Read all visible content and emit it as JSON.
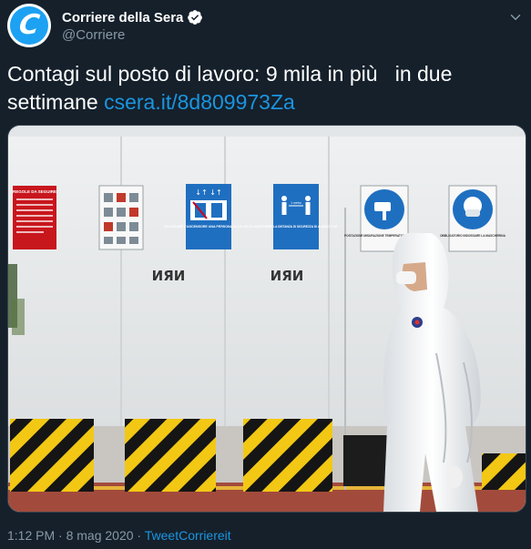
{
  "account": {
    "display_name": "Corriere della Sera",
    "handle": "@Corriere",
    "avatar_letter": "C",
    "verified": true
  },
  "tweet": {
    "text": "Contagi sul posto di lavoro: 9 mila in più   in due settimane ",
    "link": "csera.it/8d809973Za"
  },
  "media": {
    "signs": [
      {
        "title": "REGOLE DA SEGUIRE"
      },
      {
        "title": ""
      },
      {
        "title": "UTILIZZARE L'ASCENSORE UNA PERSONA ALLA VOLTA"
      },
      {
        "title": "MANTENERE LA DISTANZA DI SICUREZZA DI ALMENO 1 MT",
        "badge": "1 metro"
      },
      {
        "title": "POSTAZIONE MISURAZIONE TEMPERATURA CORPOREA"
      },
      {
        "title": "OBBLIGATORIO INDOSSARE LA MASCHERINA"
      }
    ],
    "wall_marks": [
      "ИЯИ",
      "ИЯИ"
    ]
  },
  "footer": {
    "time": "1:12 PM",
    "separator": " · ",
    "date": "8 mag 2020",
    "source": "TweetCorriereit"
  },
  "colors": {
    "background": "#15202b",
    "link": "#1b95e0",
    "secondary_text": "#8899a6",
    "brand_blue": "#1da1f2"
  },
  "icons": [
    "verified-badge-icon",
    "chevron-down-icon"
  ]
}
